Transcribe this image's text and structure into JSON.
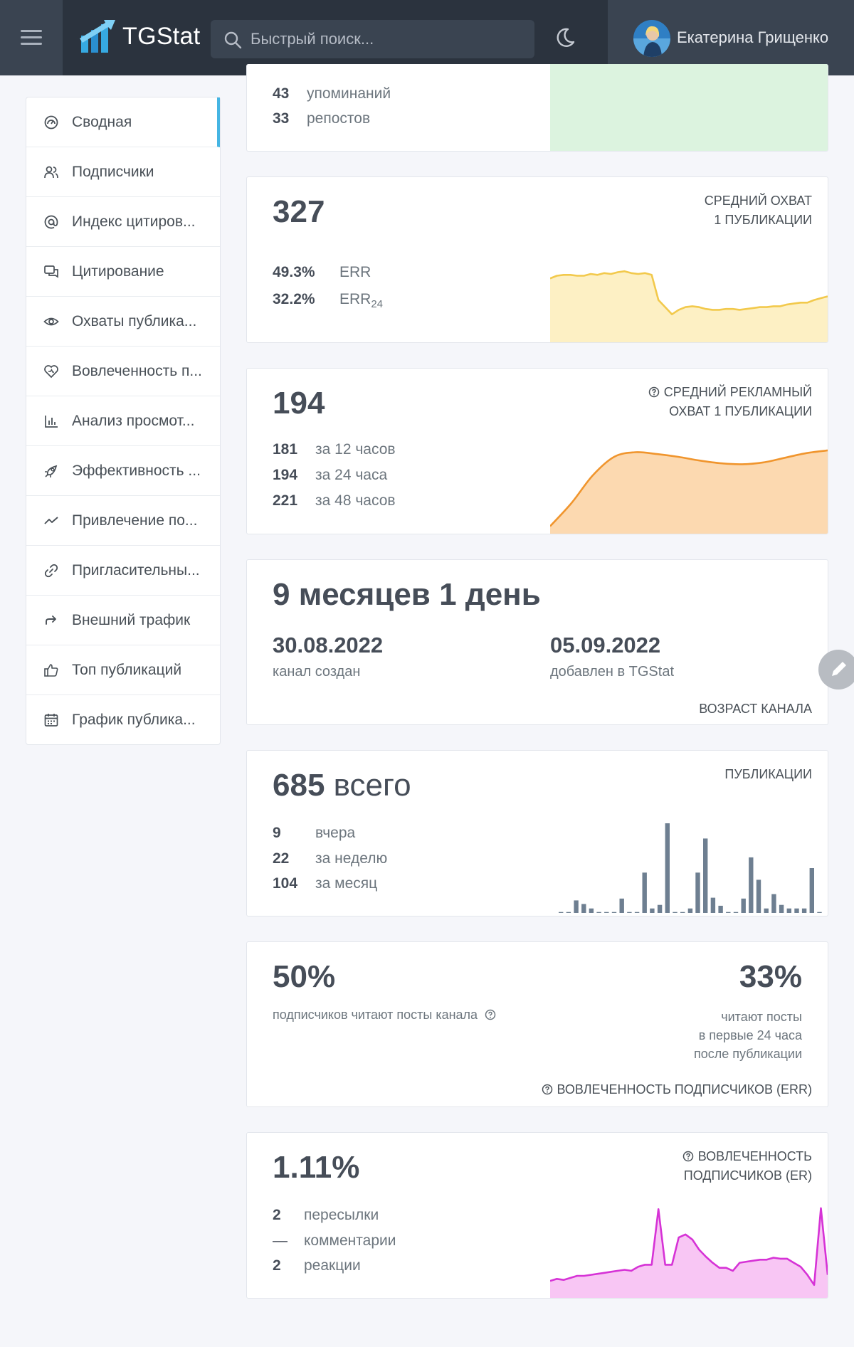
{
  "header": {
    "logo_text": "TGStat",
    "search_placeholder": "Быстрый поиск...",
    "user_name": "Екатерина Грищенко"
  },
  "sidebar": {
    "items": [
      {
        "label": "Сводная",
        "icon": "dashboard-icon",
        "active": true
      },
      {
        "label": "Подписчики",
        "icon": "users-icon"
      },
      {
        "label": "Индекс цитиров...",
        "icon": "at-icon"
      },
      {
        "label": "Цитирование",
        "icon": "quote-icon"
      },
      {
        "label": "Охваты публика...",
        "icon": "eye-icon"
      },
      {
        "label": "Вовлеченность п...",
        "icon": "heart-icon"
      },
      {
        "label": "Анализ просмот...",
        "icon": "bar-chart-icon"
      },
      {
        "label": "Эффективность ...",
        "icon": "rocket-icon"
      },
      {
        "label": "Привлечение по...",
        "icon": "trend-icon"
      },
      {
        "label": "Пригласительны...",
        "icon": "link-icon"
      },
      {
        "label": "Внешний трафик",
        "icon": "share-icon"
      },
      {
        "label": "Топ публикаций",
        "icon": "thumbs-up-icon"
      },
      {
        "label": "График публика...",
        "icon": "calendar-icon"
      }
    ]
  },
  "mentions_card": {
    "rows": [
      {
        "value": "43",
        "label": "упоминаний"
      },
      {
        "value": "33",
        "label": "репостов"
      }
    ],
    "accent_color": "#dcf3df"
  },
  "reach_card": {
    "value": "327",
    "caption_line1": "СРЕДНИЙ ОХВАТ",
    "caption_line2": "1 ПУБЛИКАЦИИ",
    "err_value": "49.3%",
    "err_label": "ERR",
    "err24_value": "32.2%",
    "err24_label": "ERR",
    "err24_sub": "24",
    "color": "#f2c94c"
  },
  "ad_reach_card": {
    "value": "194",
    "caption_line1": "СРЕДНИЙ РЕКЛАМНЫЙ",
    "caption_line2": "ОХВАТ 1 ПУБЛИКАЦИИ",
    "rows": [
      {
        "value": "181",
        "label": "за 12 часов"
      },
      {
        "value": "194",
        "label": "за 24 часа"
      },
      {
        "value": "221",
        "label": "за 48 часов"
      }
    ],
    "color": "#f0952d"
  },
  "age_card": {
    "value": "9 месяцев 1 день",
    "created_date": "30.08.2022",
    "created_label": "канал создан",
    "added_date": "05.09.2022",
    "added_label": "добавлен в TGStat",
    "caption": "ВОЗРАСТ КАНАЛА"
  },
  "posts_card": {
    "value_num": "685",
    "value_word": "всего",
    "caption": "ПУБЛИКАЦИИ",
    "rows": [
      {
        "value": "9",
        "label": "вчера"
      },
      {
        "value": "22",
        "label": "за неделю"
      },
      {
        "value": "104",
        "label": "за месяц"
      }
    ],
    "bar_color": "#6e7f91"
  },
  "err_card": {
    "left_value": "50%",
    "left_label": "подписчиков читают посты канала",
    "right_value": "33%",
    "right_line1": "читают посты",
    "right_line2": "в первые 24 часа",
    "right_line3": "после публикации",
    "caption": "ВОВЛЕЧЕННОСТЬ ПОДПИСЧИКОВ (ERR)"
  },
  "er_card": {
    "value": "1.11%",
    "caption_line1": "ВОВЛЕЧЕННОСТЬ",
    "caption_line2": "ПОДПИСЧИКОВ (ER)",
    "rows": [
      {
        "value": "2",
        "label": "пересылки"
      },
      {
        "value": "—",
        "label": "комментарии"
      },
      {
        "value": "2",
        "label": "реакции"
      }
    ],
    "color": "#d633d6"
  },
  "chart_data": [
    {
      "type": "area",
      "values": [
        0.68,
        0.71,
        0.72,
        0.72,
        0.71,
        0.71,
        0.73,
        0.72,
        0.74,
        0.73,
        0.75,
        0.76,
        0.74,
        0.73,
        0.74,
        0.72,
        0.44,
        0.36,
        0.28,
        0.33,
        0.36,
        0.37,
        0.36,
        0.34,
        0.33,
        0.33,
        0.34,
        0.34,
        0.33,
        0.34,
        0.35,
        0.36,
        0.36,
        0.37,
        0.37,
        0.39,
        0.4,
        0.41,
        0.41,
        0.44,
        0.46,
        0.48
      ],
      "ylim": [
        0,
        1
      ]
    },
    {
      "type": "area",
      "values": [
        0.05,
        0.3,
        0.6,
        0.8,
        0.85,
        0.83,
        0.8,
        0.76,
        0.73,
        0.72,
        0.74,
        0.79,
        0.84,
        0.87
      ],
      "ylim": [
        0,
        1
      ]
    },
    {
      "type": "bar",
      "values": [
        1,
        1,
        14,
        10,
        5,
        1,
        1,
        1,
        16,
        1,
        1,
        45,
        5,
        9,
        100,
        1,
        1,
        5,
        45,
        83,
        17,
        8,
        1,
        1,
        16,
        62,
        37,
        5,
        21,
        9,
        5,
        5,
        5,
        50,
        1
      ],
      "ylim": [
        0,
        100
      ]
    },
    {
      "type": "area",
      "values": [
        0.14,
        0.16,
        0.15,
        0.17,
        0.19,
        0.19,
        0.2,
        0.21,
        0.22,
        0.23,
        0.24,
        0.25,
        0.24,
        0.28,
        0.3,
        0.3,
        0.85,
        0.3,
        0.3,
        0.57,
        0.6,
        0.55,
        0.45,
        0.38,
        0.32,
        0.27,
        0.27,
        0.24,
        0.32,
        0.33,
        0.34,
        0.35,
        0.35,
        0.37,
        0.36,
        0.36,
        0.32,
        0.28,
        0.2,
        0.1,
        0.86,
        0.2
      ],
      "ylim": [
        0,
        1
      ]
    }
  ]
}
